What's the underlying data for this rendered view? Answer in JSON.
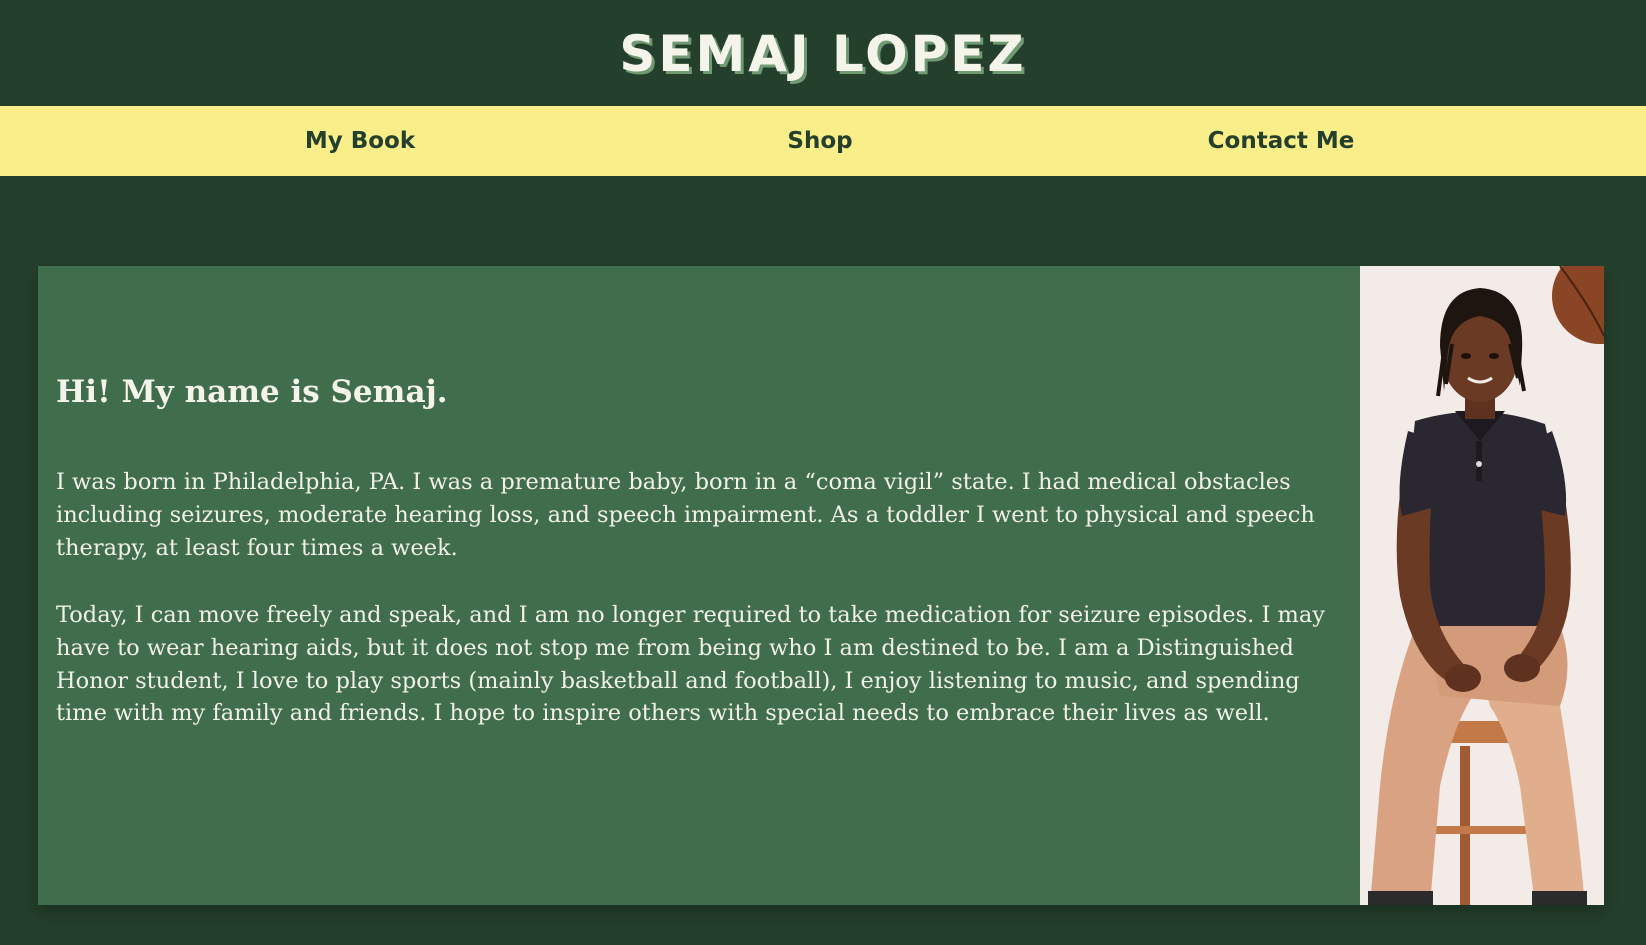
{
  "header": {
    "title": "SEMAJ LOPEZ"
  },
  "nav": {
    "items": [
      {
        "label": "My Book"
      },
      {
        "label": "Shop"
      },
      {
        "label": "Contact Me"
      }
    ]
  },
  "main": {
    "greeting": "Hi! My name is Semaj.",
    "paragraph1": "I was born in Philadelphia, PA. I was a premature baby, born in a “coma vigil” state. I had medical obstacles including seizures, moderate hearing loss, and speech impairment. As a toddler I went to physical and speech therapy, at least four times a week.",
    "paragraph2": "Today, I can move freely and speak, and I am no longer required to take medication for seizure episodes. I may have to wear hearing aids, but it does not stop me from being who I am destined to be. I am a Distinguished Honor student, I love to play sports (mainly basketball and football), I enjoy listening to music, and spending time with my family and friends. I hope to inspire others with special needs to embrace their lives as well."
  },
  "colors": {
    "background": "#243f2b",
    "nav_background": "#f9ee8a",
    "card_background": "#406d4c",
    "text_light": "#f4f4ea"
  }
}
